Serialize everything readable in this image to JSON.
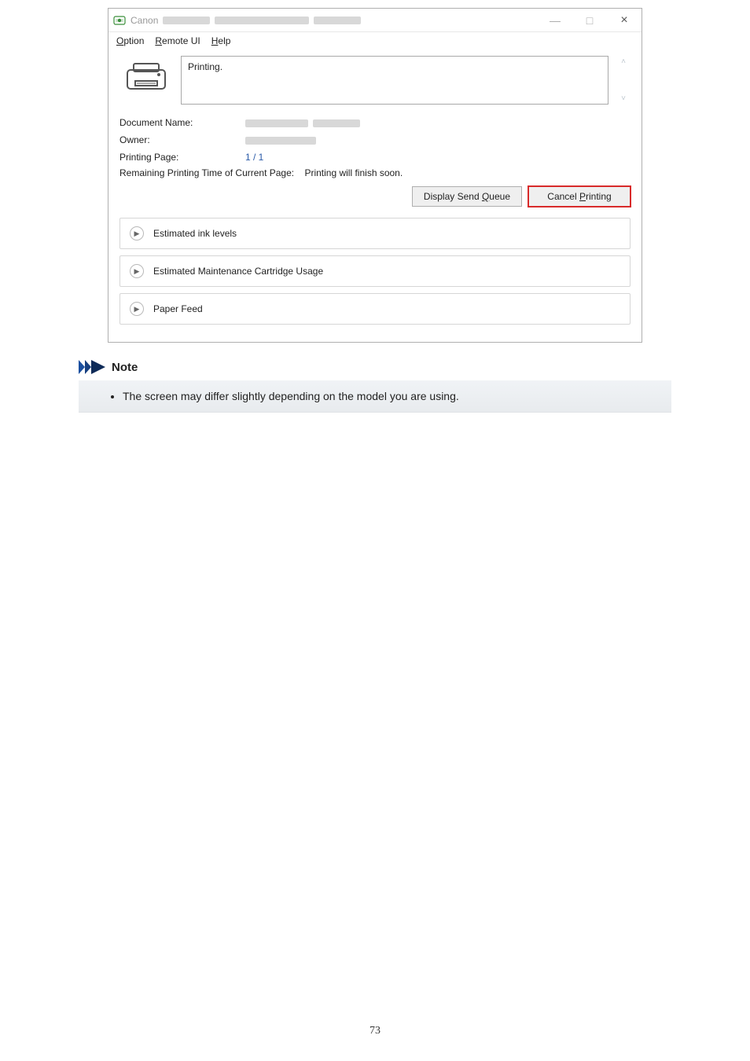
{
  "window": {
    "app_name": "Canon",
    "minimize_glyph": "—",
    "maximize_glyph": "□",
    "close_glyph": "×"
  },
  "menubar": {
    "option": {
      "pre": "",
      "u": "O",
      "post": "ption"
    },
    "remote_ui": {
      "pre": "",
      "u": "R",
      "post": "emote UI"
    },
    "help": {
      "pre": "",
      "u": "H",
      "post": "elp"
    }
  },
  "status": {
    "message": "Printing."
  },
  "info": {
    "document_name_label": "Document Name:",
    "owner_label": "Owner:",
    "printing_page_label": "Printing Page:",
    "printing_page_value": "1 / 1",
    "remaining_label": "Remaining Printing Time of Current Page:",
    "remaining_value": "Printing will finish soon."
  },
  "buttons": {
    "display_send_queue": {
      "pre": "Display Send ",
      "u": "Q",
      "post": "ueue"
    },
    "cancel_printing": {
      "pre": "Cancel ",
      "u": "P",
      "post": "rinting"
    }
  },
  "expanders": {
    "ink_levels": "Estimated ink levels",
    "maintenance_cartridge": "Estimated Maintenance Cartridge Usage",
    "paper_feed": "Paper Feed"
  },
  "note": {
    "label": "Note",
    "item1": "The screen may differ slightly depending on the model you are using."
  },
  "page_number": "73"
}
